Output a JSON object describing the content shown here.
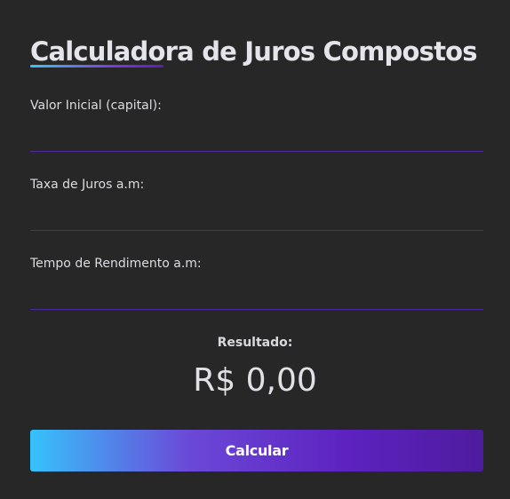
{
  "title": "Calculadora de Juros Compostos",
  "form": {
    "fields": [
      {
        "label": "Valor Inicial (capital):",
        "value": ""
      },
      {
        "label": "Taxa de Juros a.m:",
        "value": ""
      },
      {
        "label": "Tempo de Rendimento a.m:",
        "value": ""
      }
    ]
  },
  "result": {
    "label": "Resultado:",
    "value": "R$ 0,00"
  },
  "button": {
    "label": "Calcular"
  },
  "colors": {
    "background": "#272727",
    "accent_start": "#36c2fb",
    "accent_end": "#4e1c9e",
    "input_border": "#4b2a9a"
  }
}
